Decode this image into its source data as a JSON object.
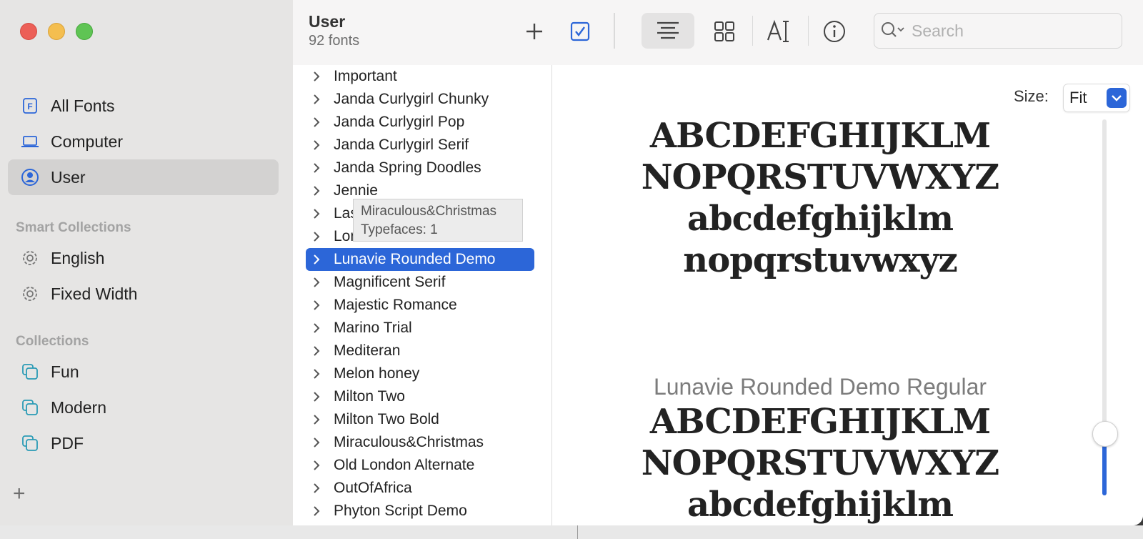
{
  "sidebar": {
    "items": [
      {
        "label": "All Fonts",
        "icon": "font-book-icon"
      },
      {
        "label": "Computer",
        "icon": "laptop-icon"
      },
      {
        "label": "User",
        "icon": "user-circle-icon",
        "selected": true
      }
    ],
    "smart_heading": "Smart Collections",
    "smart_items": [
      {
        "label": "English",
        "icon": "gear-icon"
      },
      {
        "label": "Fixed Width",
        "icon": "gear-icon"
      }
    ],
    "collections_heading": "Collections",
    "collection_items": [
      {
        "label": "Fun",
        "icon": "collection-icon"
      },
      {
        "label": "Modern",
        "icon": "collection-icon"
      },
      {
        "label": "PDF",
        "icon": "collection-icon"
      }
    ],
    "add_label": "+"
  },
  "toolbar": {
    "title": "User",
    "subtitle": "92 fonts",
    "search_placeholder": "Search"
  },
  "fontlist": {
    "rows": [
      "Important",
      "Janda Curlygirl Chunky",
      "Janda Curlygirl Pop",
      "Janda Curlygirl Serif",
      "Janda Spring Doodles",
      "Jennie",
      "Las",
      "London",
      "Lunavie Rounded Demo",
      "Magnificent Serif",
      "Majestic Romance",
      "Marino Trial",
      "Mediteran",
      "Melon honey",
      "Milton Two",
      "Milton Two Bold",
      "Miraculous&Christmas",
      "Old London Alternate",
      "OutOfAfrica",
      "Phyton Script Demo"
    ],
    "selected_index": 8
  },
  "tooltip": {
    "line1": "Miraculous&Christmas",
    "line2": "Typefaces: 1"
  },
  "preview": {
    "size_label": "Size:",
    "size_value": "Fit",
    "sample_lines": [
      "ABCDEFGHIJKLM",
      "NOPQRSTUVWXYZ",
      "abcdefghijklm",
      "nopqrstuvwxyz"
    ],
    "face_name": "Lunavie Rounded Demo Regular",
    "sample_lines_2": [
      "ABCDEFGHIJKLM",
      "NOPQRSTUVWXYZ",
      "abcdefghijklm"
    ],
    "slider_level": 0.16
  },
  "colors": {
    "accent": "#2c66d8",
    "sidebar_bg": "#e6e5e4"
  }
}
